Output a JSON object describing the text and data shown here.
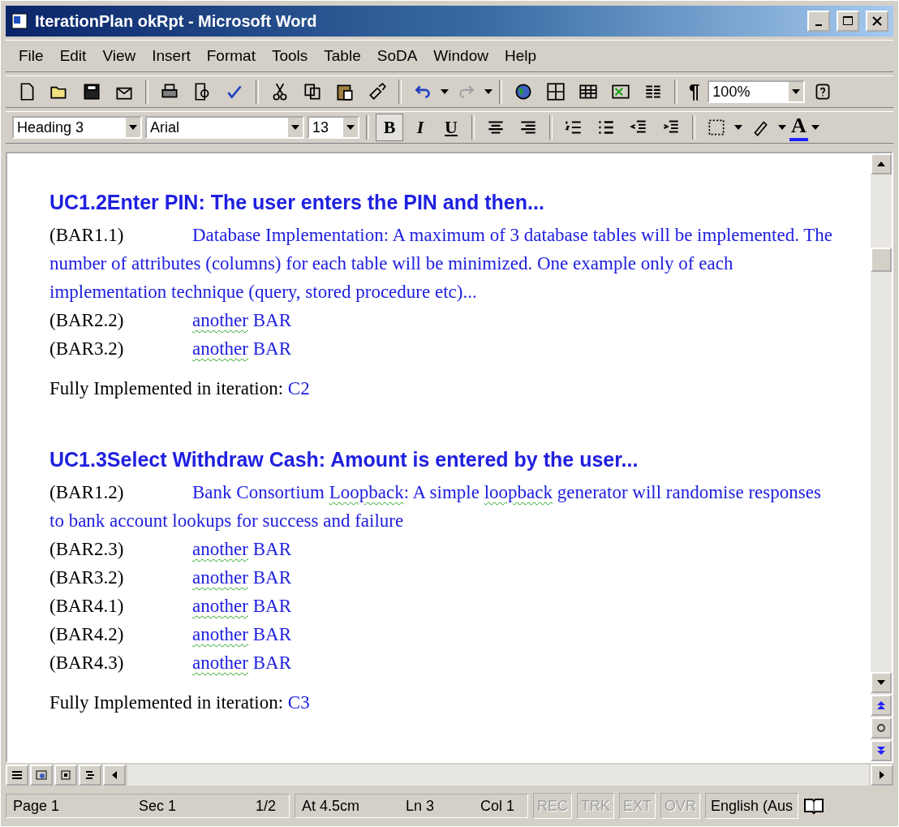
{
  "window": {
    "title": "IterationPlan okRpt - Microsoft Word"
  },
  "menu": [
    "File",
    "Edit",
    "View",
    "Insert",
    "Format",
    "Tools",
    "Table",
    "SoDA",
    "Window",
    "Help"
  ],
  "standard_toolbar": {
    "show_marks": "¶",
    "zoom": "100%"
  },
  "formatting_toolbar": {
    "style": "Heading 3",
    "font": "Arial",
    "size": "13",
    "bold": "B",
    "italic": "I",
    "underline": "U",
    "font_color": "A"
  },
  "document": [
    {
      "kind": "heading",
      "text": "UC1.2Enter PIN: The user enters the PIN and then..."
    },
    {
      "kind": "bar",
      "label": "(BAR1.1)",
      "segments": [
        {
          "text": "Database Implementation: A maximum of 3 database tables will be implemented.  The number of attributes (columns) for each table will be minimized.  One example only of each implementation technique (query, stored procedure etc)...",
          "misspelled": false
        }
      ]
    },
    {
      "kind": "bar",
      "label": "(BAR2.2)",
      "segments": [
        {
          "text": "another",
          "misspelled": true
        },
        {
          "text": " BAR",
          "misspelled": false
        }
      ]
    },
    {
      "kind": "bar",
      "label": "(BAR3.2)",
      "segments": [
        {
          "text": "another",
          "misspelled": true
        },
        {
          "text": " BAR",
          "misspelled": false
        }
      ]
    },
    {
      "kind": "iteration",
      "text": "Fully Implemented in iteration: ",
      "value": "C2"
    },
    {
      "kind": "heading",
      "text": "UC1.3Select Withdraw Cash:  Amount is entered by the user..."
    },
    {
      "kind": "bar",
      "label": "(BAR1.2)",
      "segments": [
        {
          "text": "Bank Consortium ",
          "misspelled": false
        },
        {
          "text": "Loopback",
          "misspelled": true
        },
        {
          "text": ": A simple ",
          "misspelled": false
        },
        {
          "text": "loopback",
          "misspelled": true
        },
        {
          "text": " generator will randomise responses to bank account lookups for success and failure",
          "misspelled": false
        }
      ]
    },
    {
      "kind": "bar",
      "label": "(BAR2.3)",
      "segments": [
        {
          "text": "another",
          "misspelled": true
        },
        {
          "text": " BAR",
          "misspelled": false
        }
      ]
    },
    {
      "kind": "bar",
      "label": "(BAR3.2)",
      "segments": [
        {
          "text": "another",
          "misspelled": true
        },
        {
          "text": " BAR",
          "misspelled": false
        }
      ]
    },
    {
      "kind": "bar",
      "label": "(BAR4.1)",
      "segments": [
        {
          "text": "another",
          "misspelled": true
        },
        {
          "text": " BAR",
          "misspelled": false
        }
      ]
    },
    {
      "kind": "bar",
      "label": "(BAR4.2)",
      "segments": [
        {
          "text": "another",
          "misspelled": true
        },
        {
          "text": " BAR",
          "misspelled": false
        }
      ]
    },
    {
      "kind": "bar",
      "label": "(BAR4.3)",
      "segments": [
        {
          "text": "another",
          "misspelled": true
        },
        {
          "text": " BAR",
          "misspelled": false
        }
      ]
    },
    {
      "kind": "iteration",
      "text": "Fully Implemented in iteration: ",
      "value": "C3"
    }
  ],
  "status_bar": {
    "groups": [
      [
        "Page 1",
        "Sec 1",
        "1/2"
      ],
      [
        "At 4.5cm",
        "Ln 3",
        "Col 1"
      ]
    ],
    "modes": [
      {
        "label": "REC",
        "disabled": true
      },
      {
        "label": "TRK",
        "disabled": true
      },
      {
        "label": "EXT",
        "disabled": true
      },
      {
        "label": "OVR",
        "disabled": true
      }
    ],
    "language": "English (Aus"
  }
}
